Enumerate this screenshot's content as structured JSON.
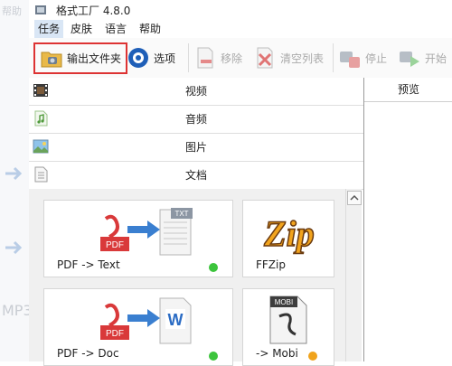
{
  "background_window": {
    "ghost_top": "帮助",
    "ghost_mid": "MP3"
  },
  "window": {
    "title": "格式工厂 4.8.0"
  },
  "menu": {
    "items": [
      "任务",
      "皮肤",
      "语言",
      "帮助"
    ],
    "active_index": 0
  },
  "toolbar": {
    "output_folder": "输出文件夹",
    "options": "选项",
    "remove": "移除",
    "clear_list": "清空列表",
    "stop": "停止",
    "start": "开始"
  },
  "categories": [
    "视频",
    "音频",
    "图片",
    "文档"
  ],
  "tools": [
    {
      "label": "PDF -> Text",
      "status_color": "#3cc43c"
    },
    {
      "label": "FFZip",
      "status_color": null
    },
    {
      "label": "PDF -> Doc",
      "status_color": "#3cc43c"
    },
    {
      "label": "-> Mobi",
      "status_color": "#f0a31c"
    }
  ],
  "icon_texts": {
    "pdf": "PDF",
    "txt": "TXT",
    "word": "W",
    "mobi": "MOBI",
    "zip": "Zip"
  },
  "preview": {
    "header": "预览"
  },
  "colors": {
    "highlight_border": "#dd3333",
    "menu_active_bg": "#d9e6f5",
    "pdf_red": "#d9393a",
    "arrow_blue": "#3a7fd0"
  }
}
